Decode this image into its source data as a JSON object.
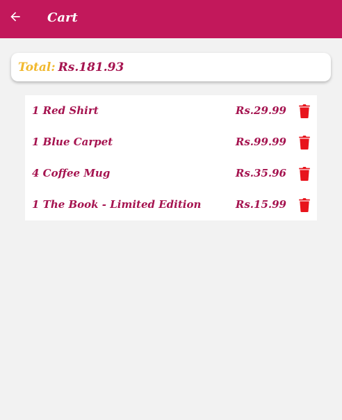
{
  "appbar": {
    "title": "Cart",
    "back_icon": "arrow-left-icon"
  },
  "colors": {
    "primary": "#c2185b",
    "accent": "#f1b82d",
    "text_primary": "#a5134f",
    "delete": "#e8141c",
    "background": "#f2f2f2"
  },
  "total": {
    "label": "Total:",
    "value": "Rs.181.93"
  },
  "cart": {
    "items": [
      {
        "name": "1 Red Shirt",
        "price": "Rs.29.99",
        "delete_icon": "trash-icon"
      },
      {
        "name": "1 Blue Carpet",
        "price": "Rs.99.99",
        "delete_icon": "trash-icon"
      },
      {
        "name": "4 Coffee Mug",
        "price": "Rs.35.96",
        "delete_icon": "trash-icon"
      },
      {
        "name": "1 The Book - Limited Edition",
        "price": "Rs.15.99",
        "delete_icon": "trash-icon"
      }
    ]
  }
}
